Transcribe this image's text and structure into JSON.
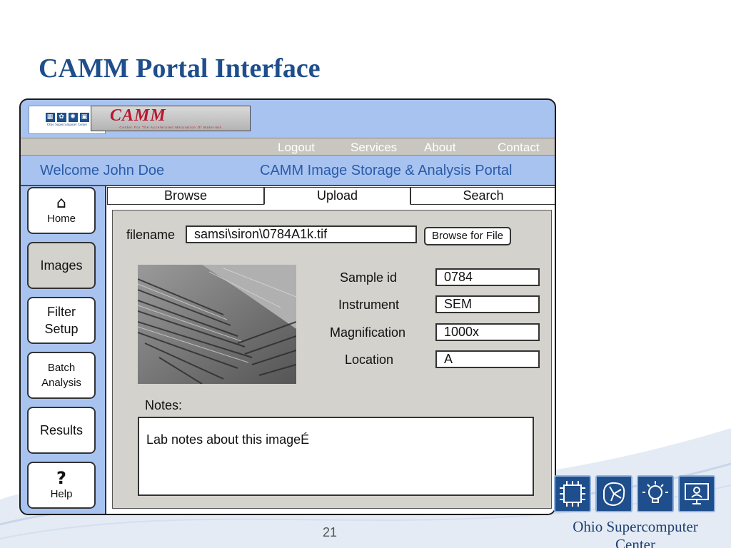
{
  "slide": {
    "title": "CAMM Portal Interface",
    "page_number": "21"
  },
  "branding": {
    "osc_logo_text": "Ohio Supercomputer Center",
    "camm_logo_word": "CAMM",
    "camm_logo_subtitle": "Center For The Accelerated Maturation Of Materials",
    "osc_footer_name": "Ohio Supercomputer Center"
  },
  "nav": {
    "logout": "Logout",
    "services": "Services",
    "about": "About",
    "contact": "Contact"
  },
  "header": {
    "welcome": "Welcome John Doe",
    "portal_title": "CAMM Image Storage & Analysis Portal"
  },
  "sidebar": {
    "items": [
      {
        "label": "Home",
        "icon": "home-icon"
      },
      {
        "label": "Images"
      },
      {
        "label_line1": "Filter",
        "label_line2": "Setup"
      },
      {
        "label_line1": "Batch",
        "label_line2": "Analysis"
      },
      {
        "label": "Results"
      },
      {
        "label": "Help",
        "icon": "help-icon",
        "glyph": "?"
      }
    ],
    "active": "Images"
  },
  "tabs": [
    {
      "label": "Browse"
    },
    {
      "label": "Upload"
    },
    {
      "label": "Search"
    }
  ],
  "upload": {
    "filename_label": "filename",
    "filename_value": "samsi\\siron\\0784A1k.tif",
    "browse_button": "Browse for File",
    "fields": [
      {
        "label": "Sample id",
        "value": "0784"
      },
      {
        "label": "Instrument",
        "value": "SEM"
      },
      {
        "label": "Magnification",
        "value": "1000x"
      },
      {
        "label": "Location",
        "value": "A"
      }
    ],
    "notes_label": "Notes:",
    "notes_value": "Lab notes about this imageÉ"
  },
  "colors": {
    "title_blue": "#1f4e8c",
    "portal_blue": "#a9c3f1",
    "panel_gray": "#d4d2cc",
    "camm_red": "#b8182e"
  }
}
